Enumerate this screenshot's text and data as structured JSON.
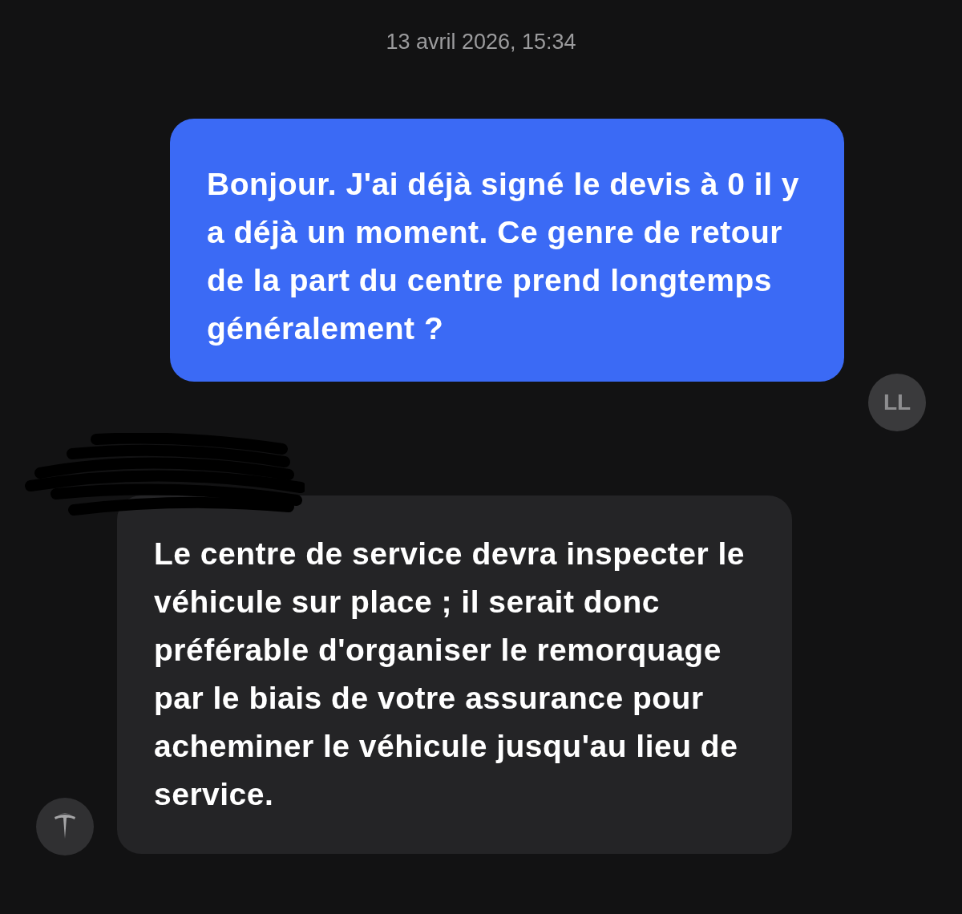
{
  "timestamp": "13 avril 2026, 15:34",
  "messages": [
    {
      "kind": "sent",
      "text": "Bonjour. J'ai déjà signé le devis à 0 il y a déjà un moment. Ce genre de retour de la part du centre prend longtemps généralement ?",
      "avatar": "LL"
    },
    {
      "kind": "received",
      "text": "Le centre de service devra inspecter le véhicule sur place ; il serait donc préférable d'organiser le remorquage par le biais de votre assurance pour acheminer le véhicule jusqu'au lieu de service.",
      "redacted_sender": true
    }
  ]
}
